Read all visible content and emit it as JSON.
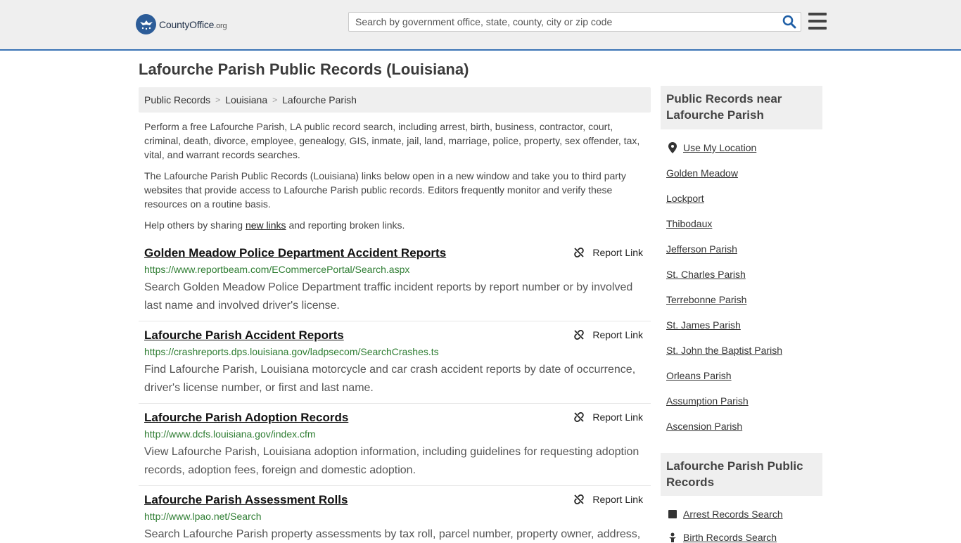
{
  "header": {
    "logo_text": "CountyOffice",
    "logo_tld": ".org",
    "search_placeholder": "Search by government office, state, county, city or zip code"
  },
  "page": {
    "title": "Lafourche Parish Public Records (Louisiana)"
  },
  "breadcrumb": [
    "Public Records",
    "Louisiana",
    "Lafourche Parish"
  ],
  "intro": {
    "p1": "Perform a free Lafourche Parish, LA public record search, including arrest, birth, business, contractor, court, criminal, death, divorce, employee, genealogy, GIS, inmate, jail, land, marriage, police, property, sex offender, tax, vital, and warrant records searches.",
    "p2": "The Lafourche Parish Public Records (Louisiana) links below open in a new window and take you to third party websites that provide access to Lafourche Parish public records. Editors frequently monitor and verify these resources on a routine basis.",
    "p3_before": "Help others by sharing ",
    "p3_link": "new links",
    "p3_after": " and reporting broken links."
  },
  "report_label": "Report Link",
  "listings": [
    {
      "title": "Golden Meadow Police Department Accident Reports",
      "url": "https://www.reportbeam.com/ECommercePortal/Search.aspx",
      "desc": "Search Golden Meadow Police Department traffic incident reports by report number or by involved last name and involved driver's license."
    },
    {
      "title": "Lafourche Parish Accident Reports",
      "url": "https://crashreports.dps.louisiana.gov/ladpsecom/SearchCrashes.ts",
      "desc": "Find Lafourche Parish, Louisiana motorcycle and car crash accident reports by date of occurrence, driver's license number, or first and last name."
    },
    {
      "title": "Lafourche Parish Adoption Records",
      "url": "http://www.dcfs.louisiana.gov/index.cfm",
      "desc": "View Lafourche Parish, Louisiana adoption information, including guidelines for requesting adoption records, adoption fees, foreign and domestic adoption."
    },
    {
      "title": "Lafourche Parish Assessment Rolls",
      "url": "http://www.lpao.net/Search",
      "desc": "Search Lafourche Parish property assessments by tax roll, parcel number, property owner, address, or legal description."
    }
  ],
  "sidebar": {
    "near_title": "Public Records near Lafourche Parish",
    "use_location": "Use My Location",
    "near_links": [
      "Golden Meadow",
      "Lockport",
      "Thibodaux",
      "Jefferson Parish",
      "St. Charles Parish",
      "Terrebonne Parish",
      "St. James Parish",
      "St. John the Baptist Parish",
      "Orleans Parish",
      "Assumption Parish",
      "Ascension Parish"
    ],
    "records_title": "Lafourche Parish Public Records",
    "records_links": [
      "Arrest Records Search",
      "Birth Records Search"
    ]
  },
  "colors": {
    "brand_blue": "#2c5c98",
    "url_green": "#2e7d32",
    "search_icon": "#1f5fa6"
  }
}
